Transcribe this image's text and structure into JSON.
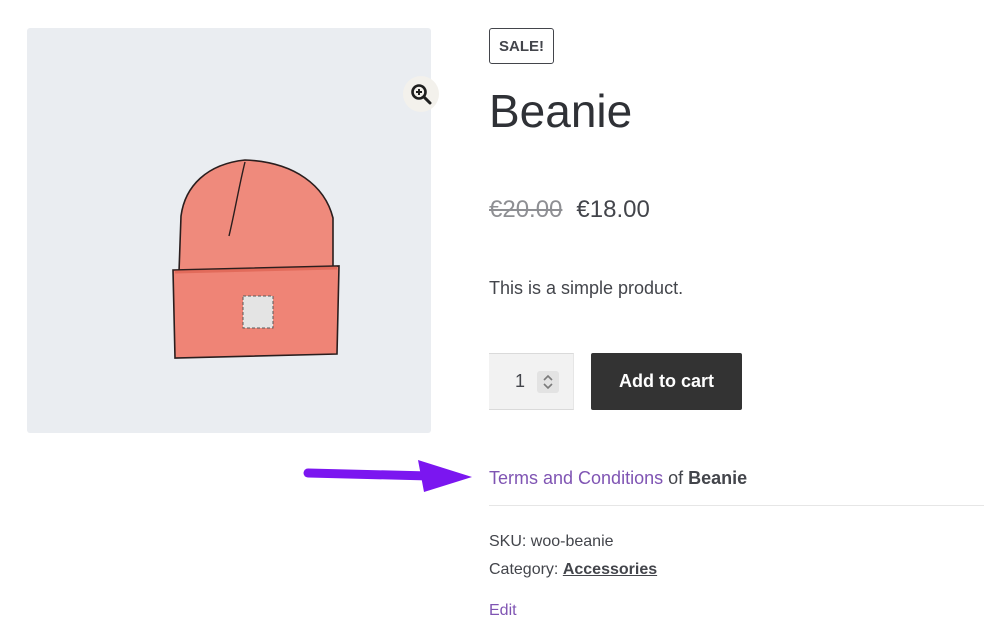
{
  "product": {
    "badge": "SALE!",
    "title": "Beanie",
    "price_old": "€20.00",
    "price_new": "€18.00",
    "description": "This is a simple product.",
    "quantity": "1",
    "add_to_cart": "Add to cart",
    "terms_link": "Terms and Conditions",
    "terms_of": "of",
    "terms_product": "Beanie",
    "sku_label": "SKU:",
    "sku": "woo-beanie",
    "category_label": "Category:",
    "category": "Accessories",
    "edit": "Edit"
  },
  "icons": {
    "zoom": "zoom-in-icon",
    "annotation": "arrow-right-icon",
    "stepper": "chevron-up-down-icon"
  },
  "colors": {
    "accent": "#7f54b3",
    "arrow": "#7b16f0",
    "button": "#333333",
    "beanie": "#ec7d70"
  }
}
